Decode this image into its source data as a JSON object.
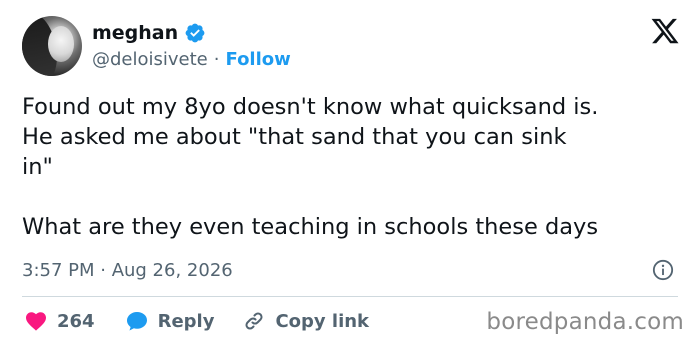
{
  "author": {
    "name": "meghan",
    "handle": "@deloisivete",
    "separator": "·",
    "follow_label": "Follow"
  },
  "icons": {
    "verified": "verified-badge-icon",
    "brand": "x-logo-icon",
    "info": "info-icon",
    "like": "heart-icon",
    "reply": "reply-bubble-icon",
    "copy_link": "link-icon"
  },
  "tweet": {
    "text": "Found out my 8yo doesn't know what quicksand is.\nHe asked me about \"that sand that you can sink\nin\"\n\nWhat are they even teaching in schools these days",
    "timestamp": "3:57 PM · Aug 26, 2026"
  },
  "actions": {
    "like_count": "264",
    "reply_label": "Reply",
    "copy_link_label": "Copy link"
  },
  "colors": {
    "accent": "#1d9bf0",
    "like": "#f91880",
    "secondary_text": "#536471",
    "primary_text": "#0f1419"
  },
  "watermark": "boredpanda.com"
}
